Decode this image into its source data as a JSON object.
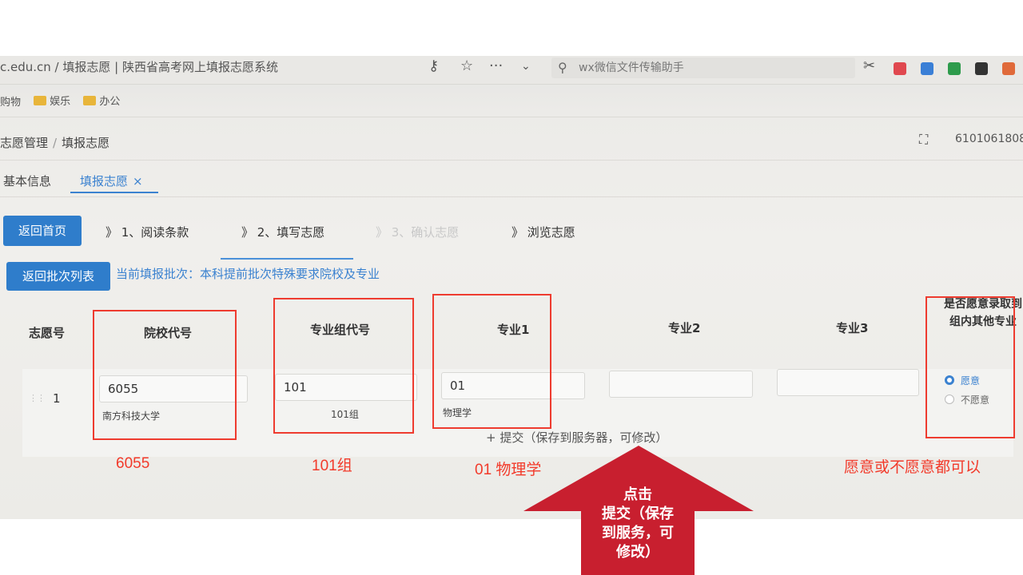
{
  "browser": {
    "url": "c.edu.cn / 填报志愿 | 陕西省高考网上填报志愿系统",
    "search_text": "wx微信文件传输助手"
  },
  "bookmarks": [
    "购物",
    "娱乐",
    "办公"
  ],
  "breadcrumb": {
    "parent": "志愿管理",
    "separator": "/",
    "current": "填报志愿"
  },
  "header": {
    "user_id": "6101061808"
  },
  "tabs": [
    {
      "label": "基本信息",
      "active": false
    },
    {
      "label": "填报志愿",
      "active": true,
      "close": "×"
    }
  ],
  "toolbar": {
    "home_button": "返回首页",
    "batch_list_button": "返回批次列表"
  },
  "steps": [
    {
      "label": "》 1、阅读条款",
      "enabled": true
    },
    {
      "label": "》 2、填写志愿",
      "enabled": true,
      "active": true
    },
    {
      "label": "》 3、确认志愿",
      "enabled": false
    },
    {
      "label": "》 浏览志愿",
      "enabled": true
    }
  ],
  "batch": {
    "text": "当前填报批次：本科提前批次特殊要求院校及专业"
  },
  "table": {
    "headers": {
      "no": "志愿号",
      "school_code": "院校代号",
      "group_code": "专业组代号",
      "major1": "专业1",
      "major2": "专业2",
      "major3": "专业3",
      "accept_other": "是否愿意录取到组内其他专业"
    },
    "row": {
      "no": "1",
      "school_code": "6055",
      "school_name": "南方科技大学",
      "group_code": "101",
      "group_name": "101组",
      "major1_code": "01",
      "major1_name": "物理学",
      "major2_code": "",
      "major3_code": "",
      "options": [
        "愿意",
        "不愿意"
      ],
      "selected": "愿意"
    },
    "submit_label": "+ 提交（保存到服务器，可修改）"
  },
  "annotations": {
    "school": "6055",
    "group": "101组",
    "major": "01 物理学",
    "accept": "愿意或不愿意都可以",
    "arrow_text": "点击\n提交（保存到服务，可修改）",
    "arrow_line1": "点击",
    "arrow_line2": "提交（保存",
    "arrow_line3": "到服务，可",
    "arrow_line4": "修改）"
  },
  "colors": {
    "primary": "#2f7dcb",
    "highlight": "#ee3b2f",
    "arrow": "#c81f2f",
    "annotation_text": "#f23a2a"
  }
}
